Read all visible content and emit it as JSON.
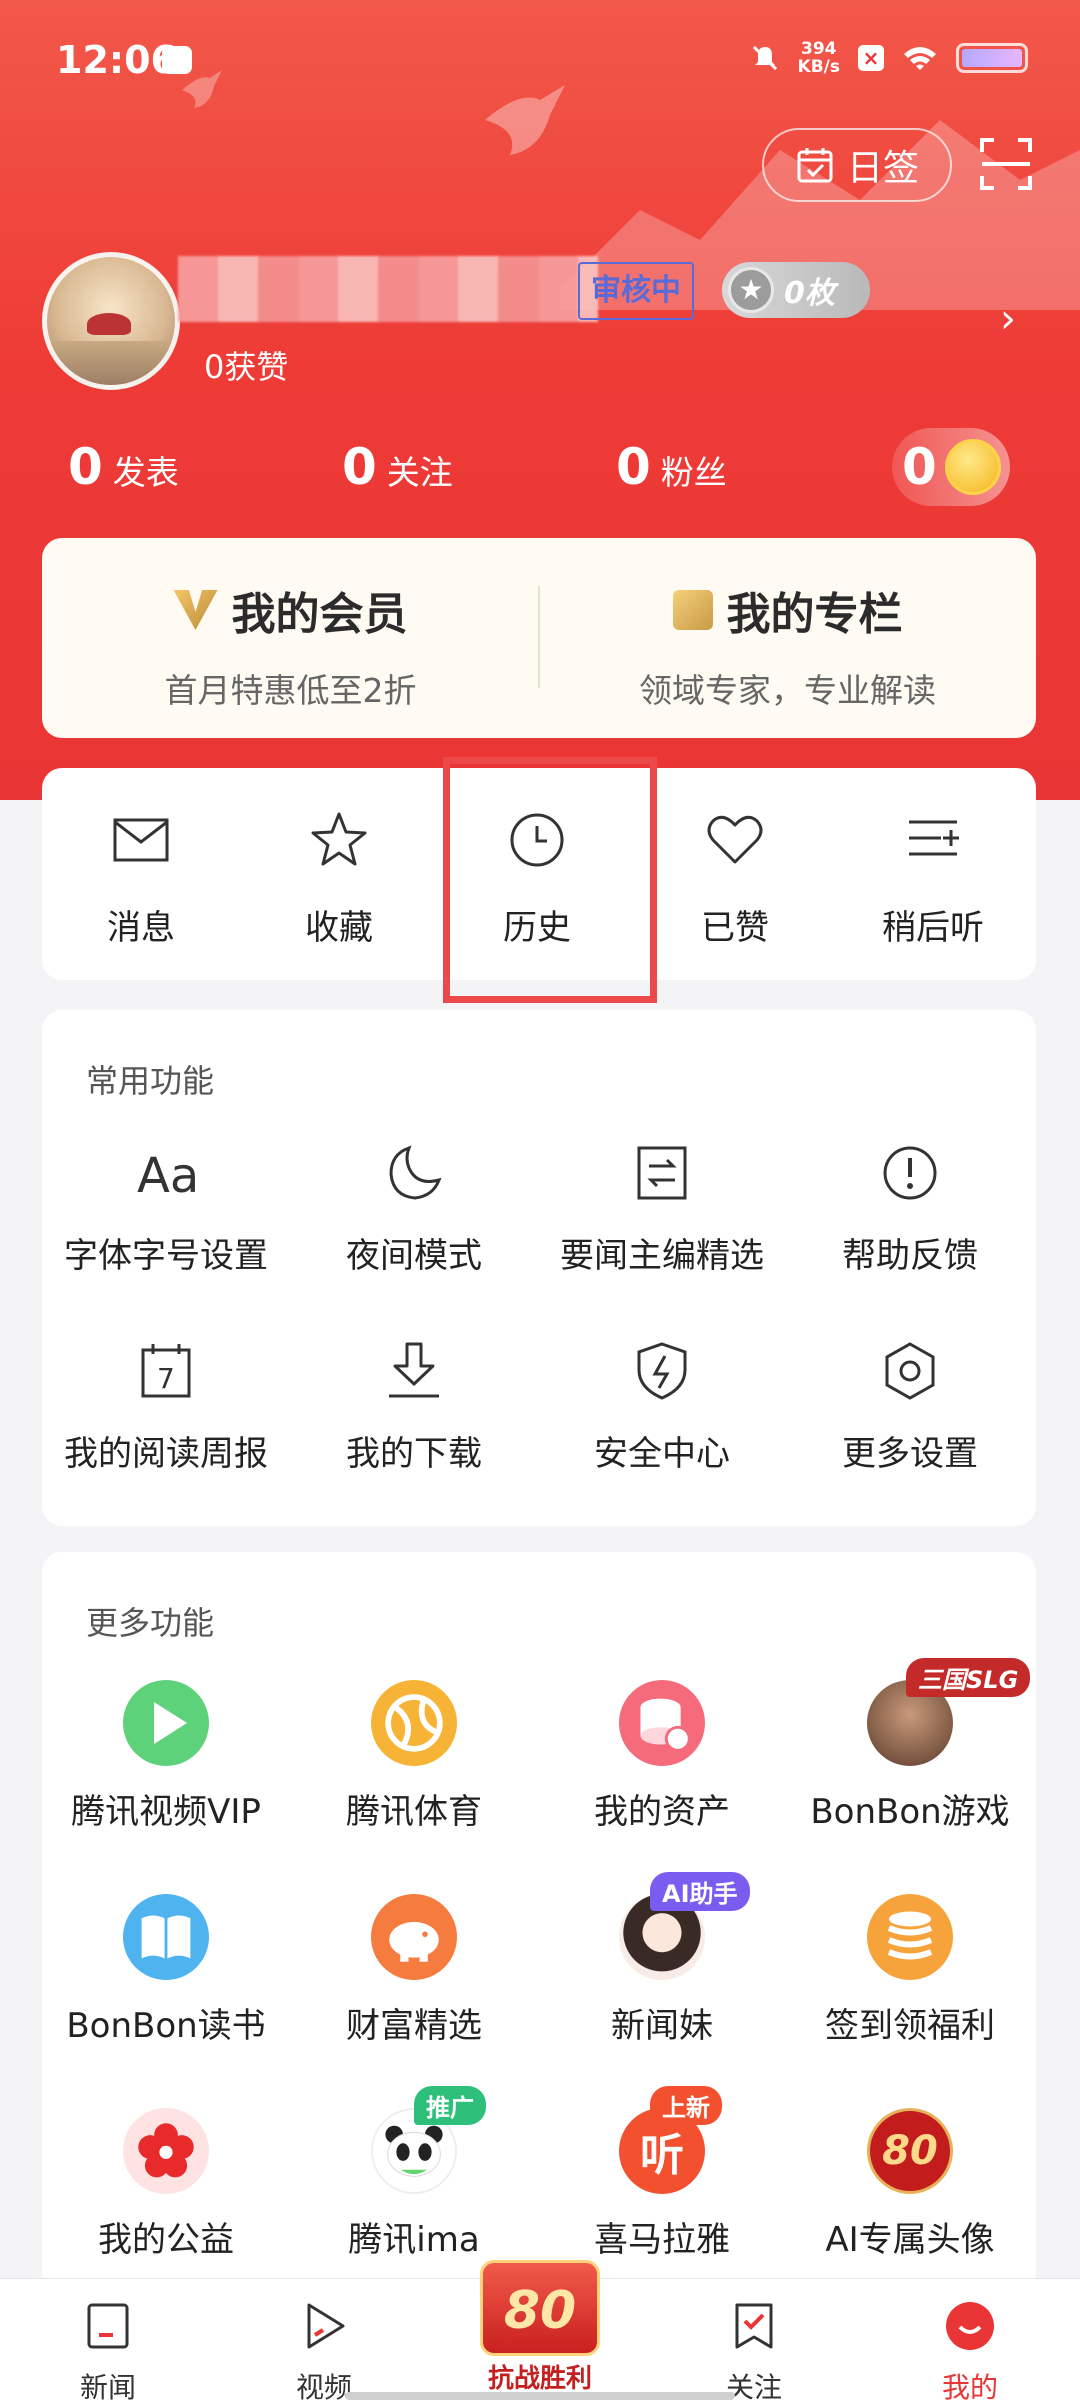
{
  "status_bar": {
    "time": "12:06",
    "speed_value": "394",
    "speed_unit": "KB/s",
    "x_badge": "×"
  },
  "header": {
    "checkin_label": "日签",
    "review_badge": "审核中",
    "medal_count": "0枚",
    "likes": "0获赞",
    "stats": [
      {
        "num": "0",
        "label": "发表"
      },
      {
        "num": "0",
        "label": "关注"
      },
      {
        "num": "0",
        "label": "粉丝"
      }
    ],
    "coins": "0"
  },
  "vip": {
    "member_title": "我的会员",
    "member_sub": "首月特惠低至2折",
    "column_title": "我的专栏",
    "column_sub": "领域专家，专业解读"
  },
  "quick": [
    {
      "label": "消息",
      "icon": "mail-icon"
    },
    {
      "label": "收藏",
      "icon": "star-icon"
    },
    {
      "label": "历史",
      "icon": "clock-icon"
    },
    {
      "label": "已赞",
      "icon": "heart-icon"
    },
    {
      "label": "稍后听",
      "icon": "playlist-add-icon"
    }
  ],
  "common": {
    "title": "常用功能",
    "items": [
      {
        "label": "字体字号设置",
        "icon": "font-size-icon"
      },
      {
        "label": "夜间模式",
        "icon": "moon-icon"
      },
      {
        "label": "要闻主编精选",
        "icon": "editor-pick-icon"
      },
      {
        "label": "帮助反馈",
        "icon": "help-icon"
      },
      {
        "label": "我的阅读周报",
        "icon": "calendar-icon"
      },
      {
        "label": "我的下载",
        "icon": "download-icon"
      },
      {
        "label": "安全中心",
        "icon": "shield-icon"
      },
      {
        "label": "更多设置",
        "icon": "settings-icon"
      }
    ]
  },
  "more": {
    "title": "更多功能",
    "items": [
      {
        "label": "腾讯视频VIP",
        "icon": "video-play-icon",
        "color": "#5dd27a"
      },
      {
        "label": "腾讯体育",
        "icon": "ball-icon",
        "color": "#f7b335"
      },
      {
        "label": "我的资产",
        "icon": "assets-icon",
        "color": "#f56b7c"
      },
      {
        "label": "BonBon游戏",
        "icon": "game-avatar-icon",
        "color": "#6b4a3a",
        "tag": "三国SLG"
      },
      {
        "label": "BonBon读书",
        "icon": "book-icon",
        "color": "#4fb3f0"
      },
      {
        "label": "财富精选",
        "icon": "piggy-icon",
        "color": "#f57b3e"
      },
      {
        "label": "新闻妹",
        "icon": "assistant-avatar-icon",
        "color": "#f0d6c9",
        "tag": "AI助手"
      },
      {
        "label": "签到领福利",
        "icon": "coins-icon",
        "color": "#f7a33c"
      },
      {
        "label": "我的公益",
        "icon": "flower-icon",
        "color": "#ffe2e2"
      },
      {
        "label": "腾讯ima",
        "icon": "panda-icon",
        "color": "#ffffff",
        "tag": "推广"
      },
      {
        "label": "喜马拉雅",
        "icon": "ting-icon",
        "color": "#f2502f",
        "tag": "上新"
      },
      {
        "label": "AI专属头像",
        "icon": "badge-80-icon",
        "color": "#c31c1c"
      }
    ]
  },
  "tabbar": {
    "tabs": [
      {
        "label": "新闻",
        "icon": "news-icon"
      },
      {
        "label": "视频",
        "icon": "video-icon"
      },
      {
        "label": "关注",
        "icon": "follow-icon"
      },
      {
        "label": "我的",
        "icon": "profile-icon"
      }
    ],
    "center_badge": "80",
    "center_label": "抗战胜利"
  },
  "colors": {
    "brand_red": "#e93535",
    "active_tab": "#e93535"
  }
}
